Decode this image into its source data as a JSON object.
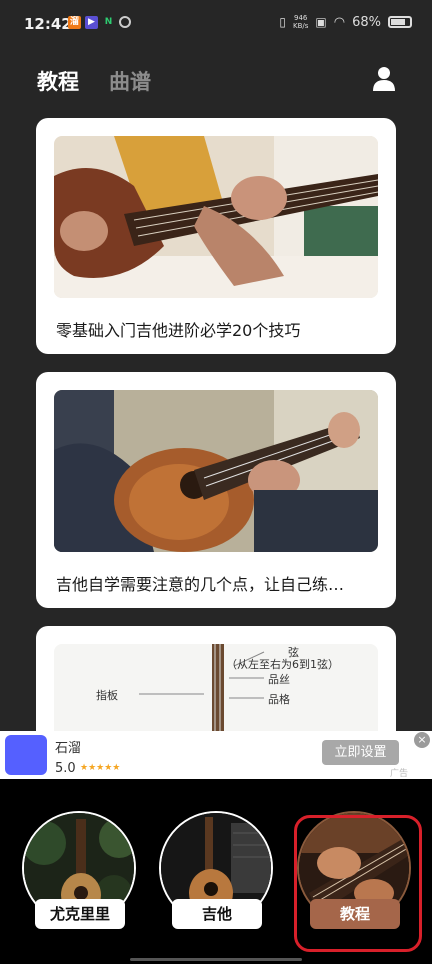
{
  "status_bar": {
    "time": "12:42",
    "net_speed_value": "946",
    "net_speed_unit": "KB/s",
    "battery": "68%"
  },
  "header": {
    "tabs": [
      {
        "label": "教程",
        "active": true
      },
      {
        "label": "曲谱",
        "active": false
      }
    ]
  },
  "articles": [
    {
      "title": "零基础入门吉他进阶必学20个技巧",
      "image": "electric-guitar-photo"
    },
    {
      "title": "吉他自学需要注意的几个点，让自己练…",
      "image": "acoustic-guitar-photo"
    },
    {
      "title": "",
      "image": "guitar-fretboard-diagram"
    }
  ],
  "diagram_labels": {
    "line1": "弦",
    "line2": "（从左至右为6到1弦）",
    "line3": "品丝",
    "line4": "品格",
    "left": "指板"
  },
  "ad": {
    "app_name": "石溜",
    "rating": "5.0",
    "stars": "★★★★★",
    "button_label": "立即设置",
    "close": "×",
    "tag": "广告"
  },
  "bottom_nav": [
    {
      "label": "尤克里里",
      "active": false
    },
    {
      "label": "吉他",
      "active": false
    },
    {
      "label": "教程",
      "active": true
    }
  ],
  "colors": {
    "background": "#262626",
    "active_nav": "#a5664a",
    "highlight": "#d8202a",
    "ad_logo": "#5560ff"
  }
}
